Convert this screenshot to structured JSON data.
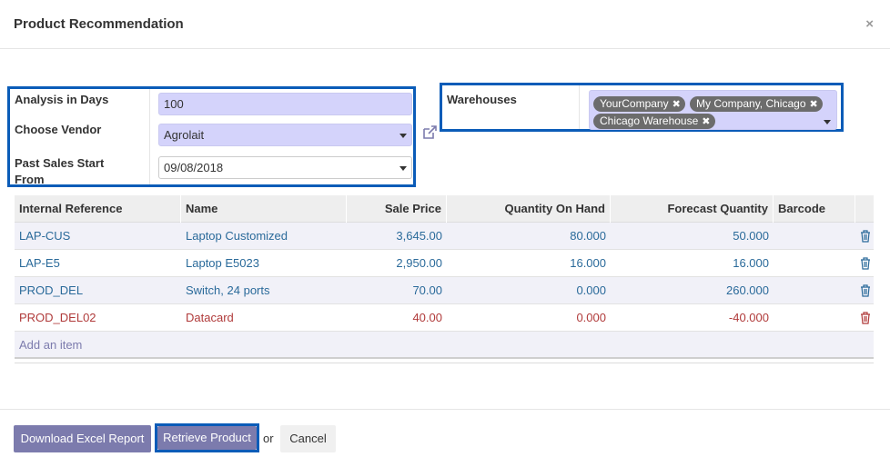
{
  "dialog": {
    "title": "Product Recommendation",
    "close_label": "×"
  },
  "form": {
    "analysis_days": {
      "label": "Analysis in Days",
      "value": "100"
    },
    "vendor": {
      "label": "Choose Vendor",
      "value": "Agrolait"
    },
    "past_sales": {
      "label": "Past Sales Start From",
      "value": "09/08/2018"
    },
    "warehouses": {
      "label": "Warehouses",
      "tags": [
        "YourCompany",
        "My Company, Chicago",
        "Chicago Warehouse"
      ]
    }
  },
  "table": {
    "headers": [
      "Internal Reference",
      "Name",
      "Sale Price",
      "Quantity On Hand",
      "Forecast Quantity",
      "Barcode"
    ],
    "rows": [
      {
        "ref": "LAP-CUS",
        "name": "Laptop Customized",
        "price": "3,645.00",
        "on_hand": "80.000",
        "forecast": "50.000",
        "barcode": ""
      },
      {
        "ref": "LAP-E5",
        "name": "Laptop E5023",
        "price": "2,950.00",
        "on_hand": "16.000",
        "forecast": "16.000",
        "barcode": ""
      },
      {
        "ref": "PROD_DEL",
        "name": "Switch, 24 ports",
        "price": "70.00",
        "on_hand": "0.000",
        "forecast": "260.000",
        "barcode": ""
      },
      {
        "ref": "PROD_DEL02",
        "name": "Datacard",
        "price": "40.00",
        "on_hand": "0.000",
        "forecast": "-40.000",
        "barcode": ""
      }
    ],
    "add_item_label": "Add an item"
  },
  "footer": {
    "download_label": "Download Excel Report",
    "retrieve_label": "Retrieve Product",
    "or_label": "or",
    "cancel_label": "Cancel"
  },
  "colors": {
    "accent": "#7c7bad",
    "highlight_border": "#0b5cb8",
    "input_bg": "#d4d3fb",
    "link_blue": "#2a6a9a",
    "negative_red": "#b03a3a"
  },
  "icons": {
    "close": "close-icon",
    "external_link": "external-link-icon",
    "dropdown": "caret-down-icon",
    "tag_remove": "x-icon",
    "row_delete": "trash-icon"
  }
}
